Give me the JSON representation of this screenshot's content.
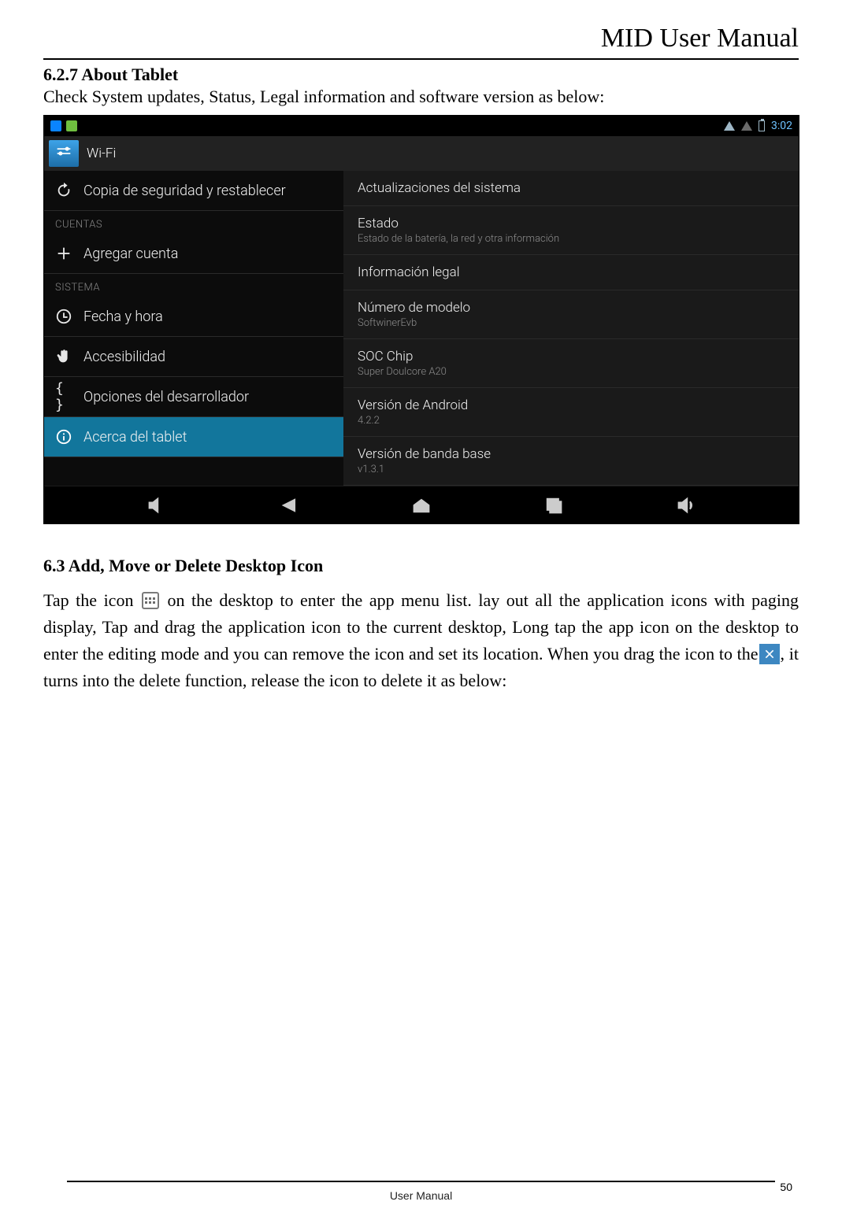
{
  "header": {
    "title": "MID User Manual"
  },
  "section1": {
    "heading": "6.2.7 About Tablet",
    "body": "Check System updates, Status, Legal information and software version as below:"
  },
  "screenshot": {
    "statusbar": {
      "clock": "3:02"
    },
    "wifi_banner": "Wi-Fi",
    "left": {
      "backup": "Copia de seguridad y restablecer",
      "cat_accounts": "CUENTAS",
      "add_account": "Agregar cuenta",
      "cat_system": "SISTEMA",
      "datetime": "Fecha y hora",
      "accessibility": "Accesibilidad",
      "devopts": "Opciones del desarrollador",
      "about": "Acerca del tablet"
    },
    "right": {
      "sysupdate": "Actualizaciones del sistema",
      "status_t": "Estado",
      "status_s": "Estado de la batería, la red y otra información",
      "legal": "Información legal",
      "model_t": "Número de modelo",
      "model_s": "SoftwinerEvb",
      "soc_t": "SOC Chip",
      "soc_s": "Super Doulcore A20",
      "android_t": "Versión de Android",
      "android_s": "4.2.2",
      "baseband_t": "Versión de banda base",
      "baseband_s": "v1.3.1"
    }
  },
  "section2": {
    "heading": "6.3 Add, Move or Delete Desktop Icon",
    "p1a": "Tap the icon ",
    "p1b": " on the desktop to enter the app menu list.    lay out all the application icons with paging display, Tap and drag the application icon to the current desktop, Long tap the app icon on the desktop to enter the editing mode and you can remove the icon and set its location. When you drag the icon to the",
    "p1c": ", it turns into the delete function, release the icon to delete it as below:"
  },
  "footer": {
    "label": "User Manual",
    "page": "50"
  }
}
